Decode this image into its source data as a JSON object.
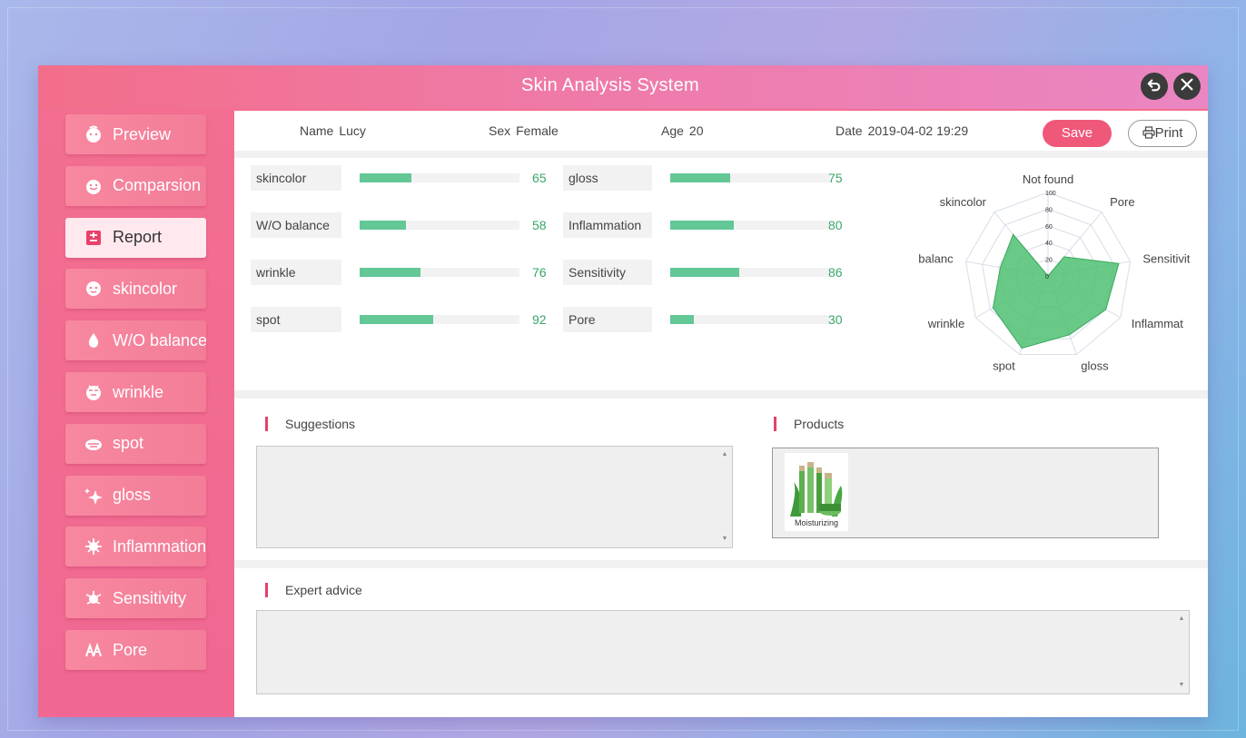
{
  "app": {
    "title": "Skin Analysis System",
    "accent": "#f0587a",
    "bar_color": "#63c796"
  },
  "window_buttons": [
    {
      "name": "back-icon"
    },
    {
      "name": "close-icon"
    }
  ],
  "nav": [
    {
      "label": "Preview",
      "icon": "face-icon",
      "active": false
    },
    {
      "label": "Comparsion",
      "icon": "face-compare-icon",
      "active": false
    },
    {
      "label": "Report",
      "icon": "report-icon",
      "active": true
    },
    {
      "label": "skincolor",
      "icon": "skincolor-icon",
      "active": false
    },
    {
      "label": "W/O balance",
      "icon": "drop-icon",
      "active": false
    },
    {
      "label": "wrinkle",
      "icon": "wrinkle-icon",
      "active": false
    },
    {
      "label": "spot",
      "icon": "spot-icon",
      "active": false
    },
    {
      "label": "gloss",
      "icon": "sparkle-icon",
      "active": false
    },
    {
      "label": "Inflammation",
      "icon": "virus-icon",
      "active": false
    },
    {
      "label": "Sensitivity",
      "icon": "sensitivity-icon",
      "active": false
    },
    {
      "label": "Pore",
      "icon": "pore-icon",
      "active": false
    }
  ],
  "info": {
    "name_label": "Name",
    "name": "Lucy",
    "sex_label": "Sex",
    "sex": "Female",
    "age_label": "Age",
    "age": "20",
    "date_label": "Date",
    "date": "2019-04-02 19:29",
    "save_label": "Save",
    "print_label": "Print"
  },
  "stats": [
    {
      "label": "skincolor",
      "value": 65
    },
    {
      "label": "W/O balance",
      "value": 58
    },
    {
      "label": "wrinkle",
      "value": 76
    },
    {
      "label": "spot",
      "value": 92
    },
    {
      "label": "gloss",
      "value": 75
    },
    {
      "label": "Inflammation",
      "value": 80
    },
    {
      "label": "Sensitivity",
      "value": 86
    },
    {
      "label": "Pore",
      "value": 30
    }
  ],
  "radar": {
    "axes": [
      "Not found",
      "Pore",
      "Sensitivit",
      "Inflammat",
      "gloss",
      "spot",
      "wrinkle",
      "W/O balanc",
      "skincolor"
    ],
    "values": [
      0,
      30,
      86,
      80,
      75,
      92,
      76,
      58,
      65
    ],
    "ticks": [
      "100",
      "80",
      "60",
      "40",
      "20",
      "0"
    ]
  },
  "suggestions": {
    "title": "Suggestions",
    "text": ""
  },
  "products": {
    "title": "Products",
    "items": [
      {
        "name": "Moisturizing"
      }
    ]
  },
  "expert": {
    "title": "Expert advice",
    "text": ""
  }
}
